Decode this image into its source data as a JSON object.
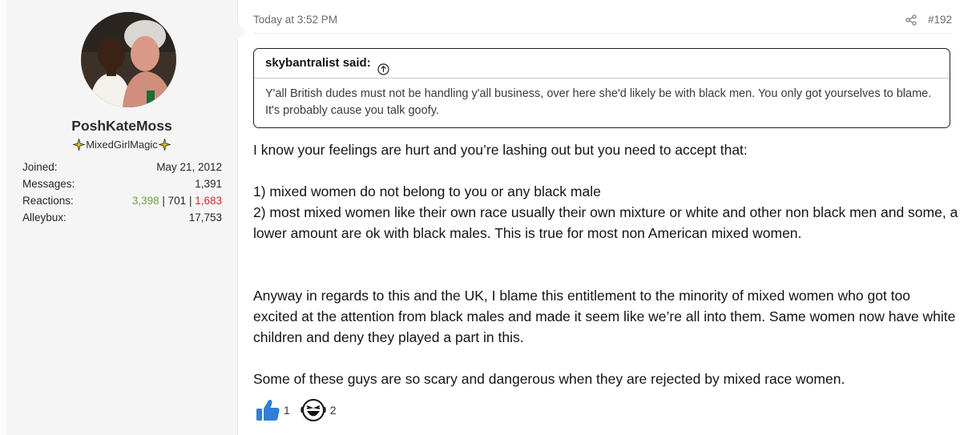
{
  "user": {
    "username": "PoshKateMoss",
    "title": "MixedGirlMagic",
    "stats": {
      "joined_label": "Joined:",
      "joined_value": "May 21, 2012",
      "messages_label": "Messages:",
      "messages_value": "1,391",
      "reactions_label": "Reactions:",
      "reactions_positive": "3,398",
      "reactions_neutral": "701",
      "reactions_negative": "1,683",
      "separator": " | ",
      "alleybux_label": "Alleybux:",
      "alleybux_value": "17,753"
    }
  },
  "post": {
    "date": "Today at 3:52 PM",
    "number": "#192",
    "quote": {
      "author": "skybantralist said:",
      "text": "Y'all British dudes must not be handling y'all business, over here she'd likely be with black men. You only got yourselves to blame. It's probably cause you talk goofy."
    },
    "body": {
      "p1": "I know your feelings are hurt and you’re lashing out but you need to accept that:",
      "p2": "1) mixed women do not belong to you or any black male",
      "p3": "2) most mixed women like their own race usually their own mixture or white and other non black men and some, a lower amount are ok with black males. This is true for most non American mixed women.",
      "p4": "Anyway in regards to this and the UK, I blame this entitlement to the minority of mixed women who got too excited at the attention from black males and made it seem like we’re all into them. Same women now have white children and deny they played a part in this.",
      "p5": "Some of these guys are so scary and dangerous when they are rejected by mixed race women."
    },
    "reactions": {
      "like_count": "1",
      "laugh_count": "2"
    }
  },
  "icons": {
    "share": "share-icon",
    "quote_link": "arrow-up-circle-icon",
    "like": "thumbs-up-icon",
    "laugh": "laughing-face-icon",
    "title_badge": "sparkle-star-icon"
  },
  "colors": {
    "reaction_positive": "#6aa33a",
    "reaction_negative": "#c0302a",
    "like_blue": "#2f7fd8"
  }
}
